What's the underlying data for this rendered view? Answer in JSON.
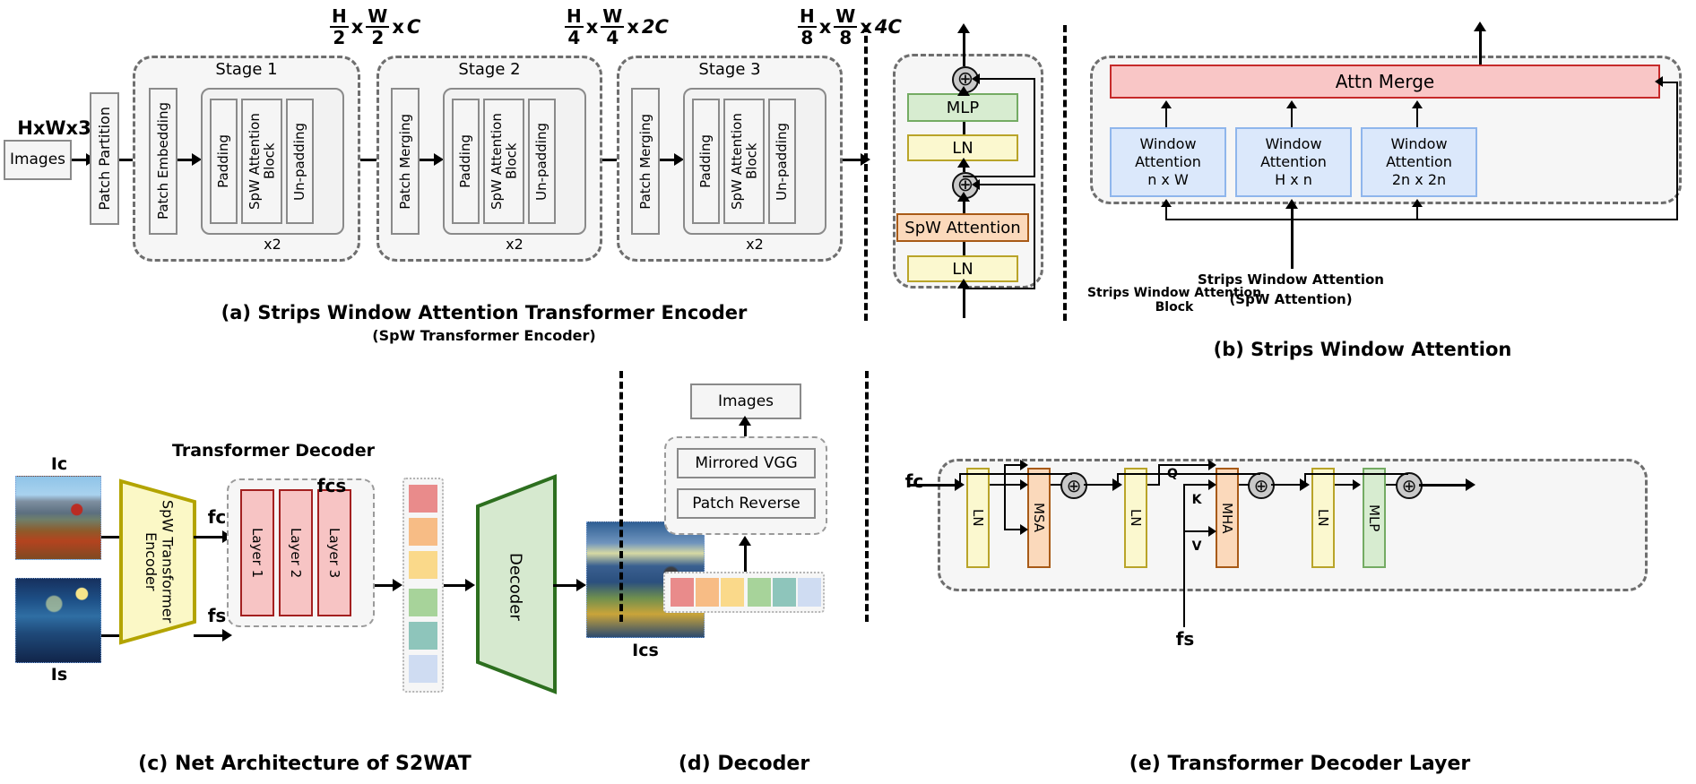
{
  "panel_a": {
    "caption_line1": "(a) Strips Window Attention Transformer Encoder",
    "caption_line2": "(SpW Transformer Encoder)",
    "input_label": "HxWx3",
    "images_box": "Images",
    "patch_partition": "Patch Partition",
    "stages": [
      {
        "title": "Stage 1",
        "entry": "Patch Embedding",
        "inner": [
          "Padding",
          "SpW Attention Block",
          "Un-padding"
        ],
        "repeat": "x2",
        "out_dim": {
          "h_num": "H",
          "h_den": "2",
          "w_num": "W",
          "w_den": "2",
          "channels": "C"
        }
      },
      {
        "title": "Stage 2",
        "entry": "Patch Merging",
        "inner": [
          "Padding",
          "SpW Attention Block",
          "Un-padding"
        ],
        "repeat": "x2",
        "out_dim": {
          "h_num": "H",
          "h_den": "4",
          "w_num": "W",
          "w_den": "4",
          "channels": "2C"
        }
      },
      {
        "title": "Stage 3",
        "entry": "Patch Merging",
        "inner": [
          "Padding",
          "SpW Attention Block",
          "Un-padding"
        ],
        "repeat": "x2",
        "out_dim": {
          "h_num": "H",
          "h_den": "8",
          "w_num": "W",
          "w_den": "8",
          "channels": "4C"
        }
      }
    ],
    "times_symbol": "x"
  },
  "panel_b": {
    "caption": "(b) Strips Window Attention",
    "block_label": "Strips Window Attention Block",
    "attention_label_line1": "Strips Window Attention",
    "attention_label_line2": "(SpW Attention)",
    "block_stack": [
      "LN",
      "SpW Attention",
      "LN",
      "MLP"
    ],
    "merge_label": "Attn Merge",
    "windows": [
      {
        "line1": "Window",
        "line2": "Attention",
        "line3": "n x W"
      },
      {
        "line1": "Window",
        "line2": "Attention",
        "line3": "H x n"
      },
      {
        "line1": "Window",
        "line2": "Attention",
        "line3": "2n x 2n"
      }
    ],
    "plus_symbol": "⊕"
  },
  "panel_c": {
    "caption": "(c) Net Architecture of S2WAT",
    "content_image_label": "Ic",
    "style_image_label": "Is",
    "output_image_label": "Ics",
    "encoder_label": "SpW Transformer Encoder",
    "decoder_title": "Transformer Decoder",
    "layers": [
      "Layer 1",
      "Layer 2",
      "Layer 3"
    ],
    "feat_content": "fc",
    "feat_style": "fs",
    "feat_cs": "fcs",
    "decoder_label": "Decoder",
    "token_colors": [
      "#e98b8b",
      "#f7bc85",
      "#fad98a",
      "#a7d39a",
      "#8ec5bb",
      "#cfdcf2"
    ]
  },
  "panel_d": {
    "caption": "(d) Decoder",
    "images_box": "Images",
    "blocks": [
      "Mirrored VGG",
      "Patch Reverse"
    ],
    "token_colors": [
      "#e98b8b",
      "#f7bc85",
      "#fad98a",
      "#a7d39a",
      "#8ec5bb",
      "#cfdcf2"
    ]
  },
  "panel_e": {
    "caption": "(e) Transformer Decoder Layer",
    "input_content": "fc",
    "input_style": "fs",
    "blocks": [
      "LN",
      "MSA",
      "LN",
      "MHA",
      "LN",
      "MLP"
    ],
    "qkv": [
      "Q",
      "K",
      "V"
    ],
    "plus_symbol": "⊕"
  },
  "colors": {
    "ln": "#fbf8cf",
    "mlp": "#d7ecd0",
    "attention": "#fbd9bb",
    "merge": "#f9c6c6",
    "window": "#dbe8fb",
    "layer": "#f7c4c4",
    "encoder": "#fbf8c6",
    "decoder": "#d6e9cf"
  }
}
